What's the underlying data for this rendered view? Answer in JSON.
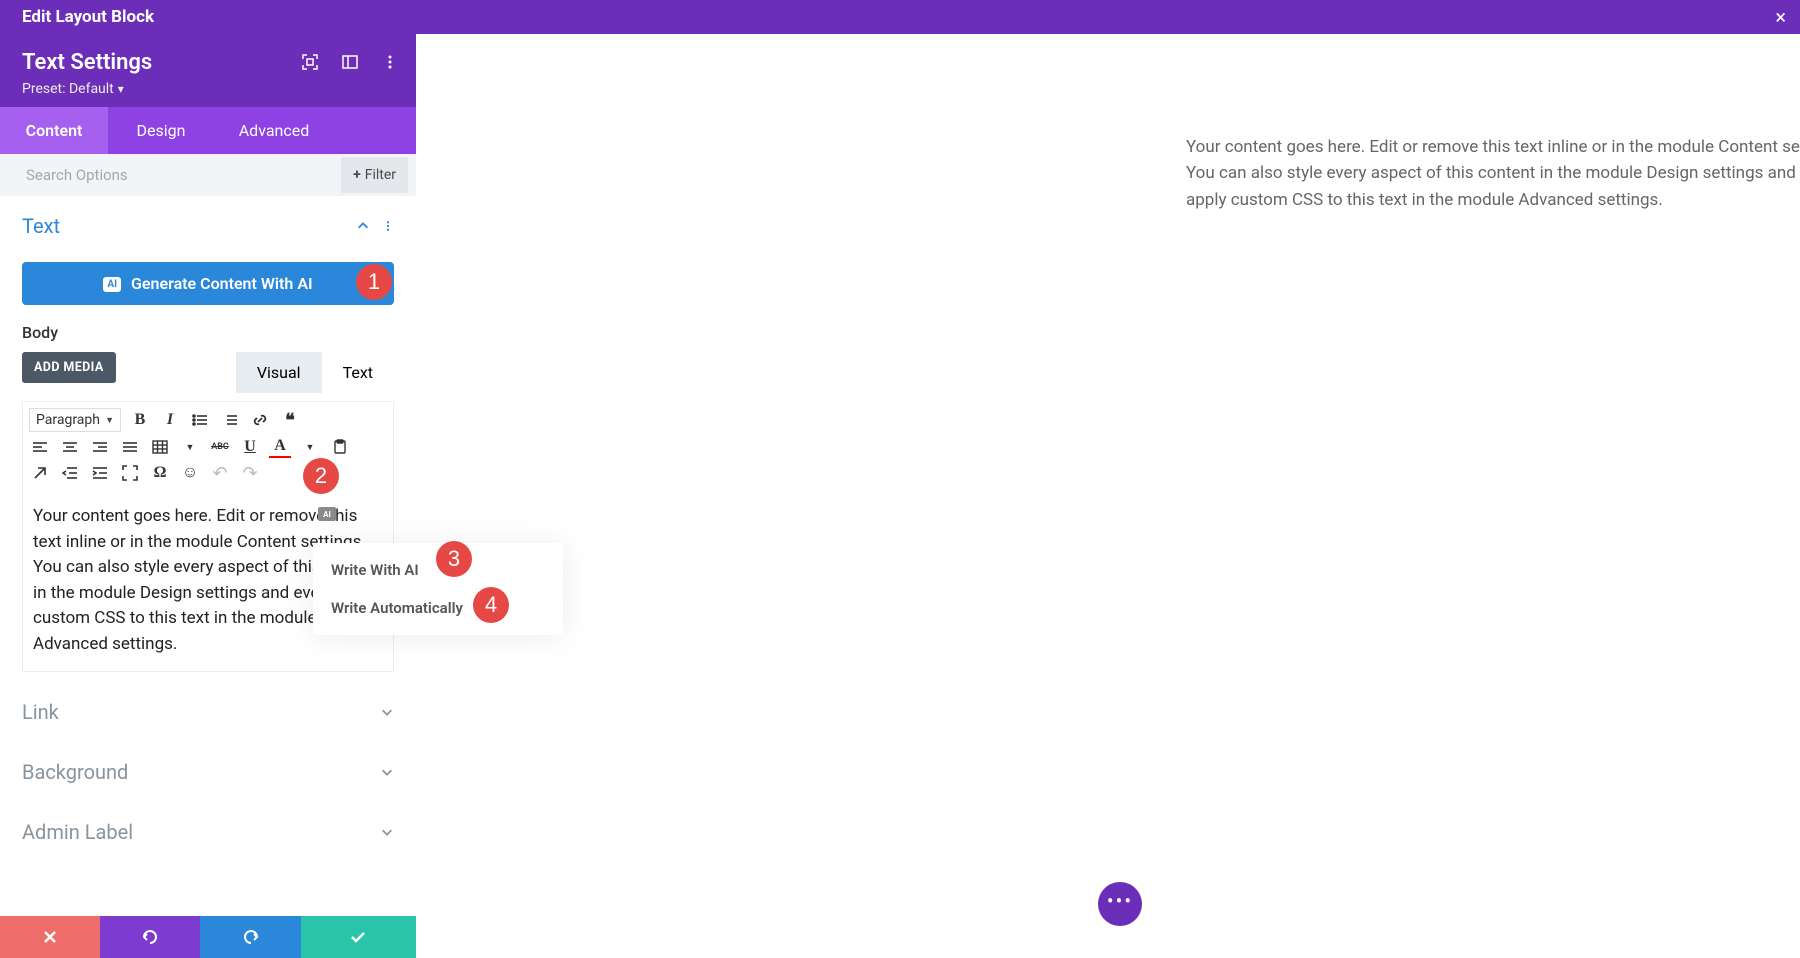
{
  "header": {
    "title": "Edit Layout Block"
  },
  "panel": {
    "title": "Text Settings",
    "preset": "Preset: Default"
  },
  "tabs": {
    "content": "Content",
    "design": "Design",
    "advanced": "Advanced"
  },
  "search": {
    "placeholder": "Search Options",
    "filter": "Filter"
  },
  "section": {
    "text": "Text",
    "link": "Link",
    "background": "Background",
    "admin_label": "Admin Label"
  },
  "ai_button": {
    "label": "Generate Content With AI",
    "badge": "AI"
  },
  "body_label": "Body",
  "add_media": "ADD MEDIA",
  "editor_tabs": {
    "visual": "Visual",
    "text": "Text"
  },
  "para_label": "Paragraph",
  "editor_text": "Your content goes here. Edit or remove this text inline or in the module Content settings. You can also style every aspect of this content in the module Design settings and even apply custom CSS to this text in the module Advanced settings.",
  "popup": {
    "write_ai": "Write With AI",
    "write_auto": "Write Automatically"
  },
  "badges": {
    "b1": "1",
    "b2": "2",
    "b3": "3",
    "b4": "4"
  },
  "preview_text": "Your content goes here. Edit or remove this text inline or in the module Content settings. You can also style every aspect of this content in the module Design settings and even apply custom CSS to this text in the module Advanced settings.",
  "icons": {
    "bold": "B",
    "italic": "I",
    "quote": "❝",
    "link": "🔗",
    "underline": "U",
    "text_a": "A",
    "abc": "ABC",
    "smile": "☺",
    "omega": "Ω",
    "undo": "↶",
    "redo": "↷",
    "close": "×"
  }
}
